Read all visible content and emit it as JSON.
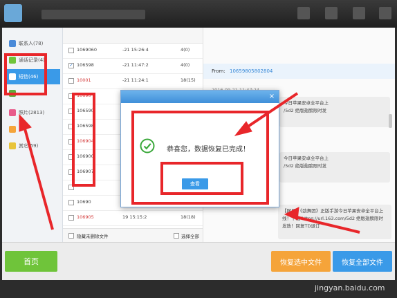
{
  "sidebar": {
    "items": [
      {
        "label": "联系人(78)",
        "color": "#4a8ad8"
      },
      {
        "label": "通话记录(4)",
        "color": "#6fc43a"
      },
      {
        "label": "短信(46)",
        "color": "#3ab8e8"
      },
      {
        "label": "",
        "color": "#5fae3a"
      },
      {
        "label": "照片(2813)",
        "color": "#e85a8a"
      },
      {
        "label": "",
        "color": "#f5a43a"
      },
      {
        "label": "其它(59)",
        "color": "#e8c43a"
      }
    ]
  },
  "messages": [
    {
      "number": "1069060",
      "time": "-21 15:26:4",
      "count": "4(0)",
      "checked": false,
      "red": false
    },
    {
      "number": "106598",
      "time": "-21 11:47:2",
      "count": "4(0)",
      "checked": true,
      "red": false
    },
    {
      "number": "10001",
      "time": "-21 11:24:1",
      "count": "18(15)",
      "checked": false,
      "red": true
    },
    {
      "number": "10690",
      "time": "",
      "count": "",
      "checked": false,
      "red": true
    },
    {
      "number": "106590",
      "time": "",
      "count": "",
      "checked": false,
      "red": false
    },
    {
      "number": "106598",
      "time": "",
      "count": "",
      "checked": false,
      "red": false
    },
    {
      "number": "106904",
      "time": "",
      "count": "",
      "checked": false,
      "red": true
    },
    {
      "number": "106900",
      "time": "",
      "count": "",
      "checked": false,
      "red": false
    },
    {
      "number": "106907",
      "time": "",
      "count": "",
      "checked": false,
      "red": false
    },
    {
      "number": "",
      "time": "",
      "count": "",
      "checked": false,
      "red": false
    },
    {
      "number": "10690",
      "time": "",
      "count": "",
      "checked": false,
      "red": false
    },
    {
      "number": "106905",
      "time": "19 15:15:2",
      "count": "18(18)",
      "checked": false,
      "red": true
    }
  ],
  "list_footer": {
    "hide_deleted": "隐藏未删除文件",
    "select_all": "选择全部"
  },
  "detail": {
    "from_label": "From:",
    "from_number": "10659805802804",
    "timestamp": "2016-09-21 11:47:24",
    "bubbles": [
      "今日苹果安卓全平台上\n/5d2 绝版翅膀限时发",
      "今日苹果安卓全平台上\n/5d2 绝版翅膀限时发",
      "【网易】《劲舞团》正版手游今日苹果安卓全平台上线！下载 https://url.163.com/5d2 绝版翅膀限时发放！回复TD退订"
    ]
  },
  "dialog": {
    "message": "恭喜您，数据恢复已完成！",
    "ok_label": "查看",
    "close_glyph": "×"
  },
  "bottom": {
    "home_label": "首页",
    "restore_selected_label": "恢复选中文件",
    "restore_all_label": "恢复全部文件"
  },
  "watermark": "jingyan.baidu.com",
  "colors": {
    "annotation_red": "#e8262a",
    "accent_blue": "#3a9ae8",
    "home_green": "#6fc43a",
    "restore_orange": "#f5a43a"
  }
}
